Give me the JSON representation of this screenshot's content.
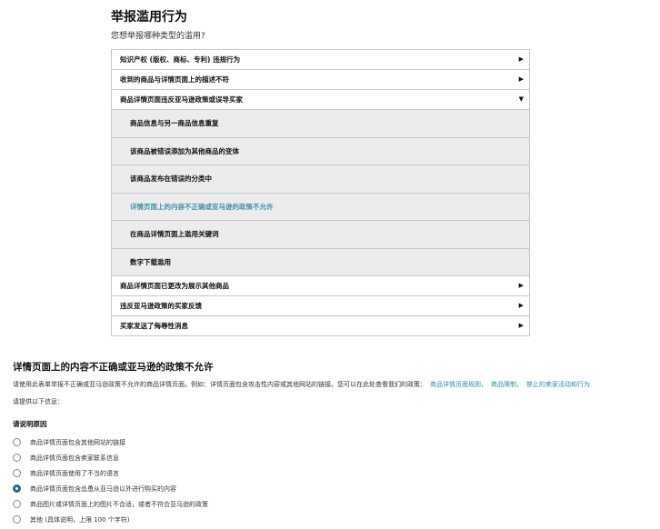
{
  "page": {
    "title": "举报滥用行为",
    "subtitle": "您想举报哪种类型的滥用?"
  },
  "accordion": {
    "top_items": [
      {
        "label": "知识产权 (版权、商标、专利) 违规行为",
        "arrow": "▶"
      },
      {
        "label": "收到的商品与详情页面上的描述不符",
        "arrow": "▶"
      }
    ],
    "expanded": {
      "label": "商品详情页面违反亚马逊政策或误导买家",
      "arrow": "▼",
      "sub_items": [
        "商品信息与另一商品信息重复",
        "该商品被错误添加为其他商品的变体",
        "该商品发布在错误的分类中",
        "详情页面上的内容不正确或亚马逊的政策不允许",
        "在商品详情页面上滥用关键词",
        "数字下载滥用"
      ]
    },
    "bottom_items": [
      {
        "label": "商品详情页面已更改为展示其他商品",
        "arrow": "▶"
      },
      {
        "label": "违反亚马逊政策的买家反馈",
        "arrow": "▶"
      },
      {
        "label": "买家发送了侮辱性消息",
        "arrow": "▶"
      }
    ]
  },
  "detail": {
    "title": "详情页面上的内容不正确或亚马逊的政策不允许",
    "description": "请使用此表单举报不正确或亚马逊政策不允许的商品详情页面。例如：详情页面包含攻击性内容或其他网站的链接。您可以在此处查看我们的政策：",
    "links": [
      "商品详情页面规则，",
      "商品限制，",
      "禁止的卖家活动和行为"
    ],
    "provide_info": "请提供以下信息：",
    "reason_heading": "请说明原因",
    "options": [
      {
        "label": "商品详情页面包含其他网站的链接",
        "checked": false
      },
      {
        "label": "商品详情页面包含卖家联系信息",
        "checked": false
      },
      {
        "label": "商品详情页面使用了不当的语言",
        "checked": false
      },
      {
        "label": "商品详情页面包含怂恿从亚马逊以外进行购买的内容",
        "checked": true
      },
      {
        "label": "商品图片或详情页面上的图片不合适，或者不符合亚马逊的政策",
        "checked": false
      },
      {
        "label": "其他 (具体说明，上限 100 个字符)",
        "checked": false
      }
    ]
  },
  "colors": {
    "selected_text": "#3d95a8",
    "link": "#2a8e9e",
    "radio_checked": "#1f6d7a"
  }
}
